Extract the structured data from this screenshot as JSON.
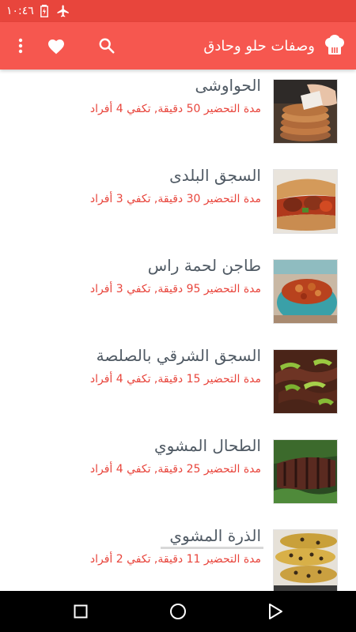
{
  "status_bar": {
    "time": "١٠:٤٦",
    "icons": [
      "airplane-mode-icon",
      "battery-charging-icon"
    ]
  },
  "app_bar": {
    "title": "وصفات حلو وحادق",
    "logo_icon": "chef-hat-icon",
    "actions": [
      "search-icon",
      "heart-icon",
      "more-vert-icon"
    ]
  },
  "colors": {
    "status_bar": "#e8453c",
    "app_bar": "#f6574f",
    "recipe_title": "#505a64",
    "recipe_meta": "#e8453c",
    "nav_bar": "#000000"
  },
  "recipes": [
    {
      "title": "الحواوشى",
      "meta": "مدة التحضير 50 دقيقة, تكفي 4 أفراد",
      "image": "hawawshi-photo"
    },
    {
      "title": "السجق البلدى",
      "meta": "مدة التحضير 30 دقيقة, تكفي 3 أفراد",
      "image": "sausage-sandwich-photo"
    },
    {
      "title": "طاجن لحمة راس",
      "meta": "مدة التحضير 95 دقيقة, تكفي 3 أفراد",
      "image": "meat-tagine-photo"
    },
    {
      "title": "السجق الشرقي بالصلصة",
      "meta": "مدة التحضير 15 دقيقة, تكفي 4 أفراد",
      "image": "sausage-peppers-photo"
    },
    {
      "title": "الطحال المشوي",
      "meta": "مدة التحضير 25 دقيقة, تكفي 4 أفراد",
      "image": "grilled-spleen-photo"
    },
    {
      "title": "الذرة المشوي",
      "meta": "مدة التحضير 11 دقيقة, تكفي 2 أفراد",
      "image": "grilled-corn-photo"
    }
  ],
  "nav_bar": {
    "buttons": [
      "recent-apps-icon",
      "home-icon",
      "back-icon"
    ]
  }
}
